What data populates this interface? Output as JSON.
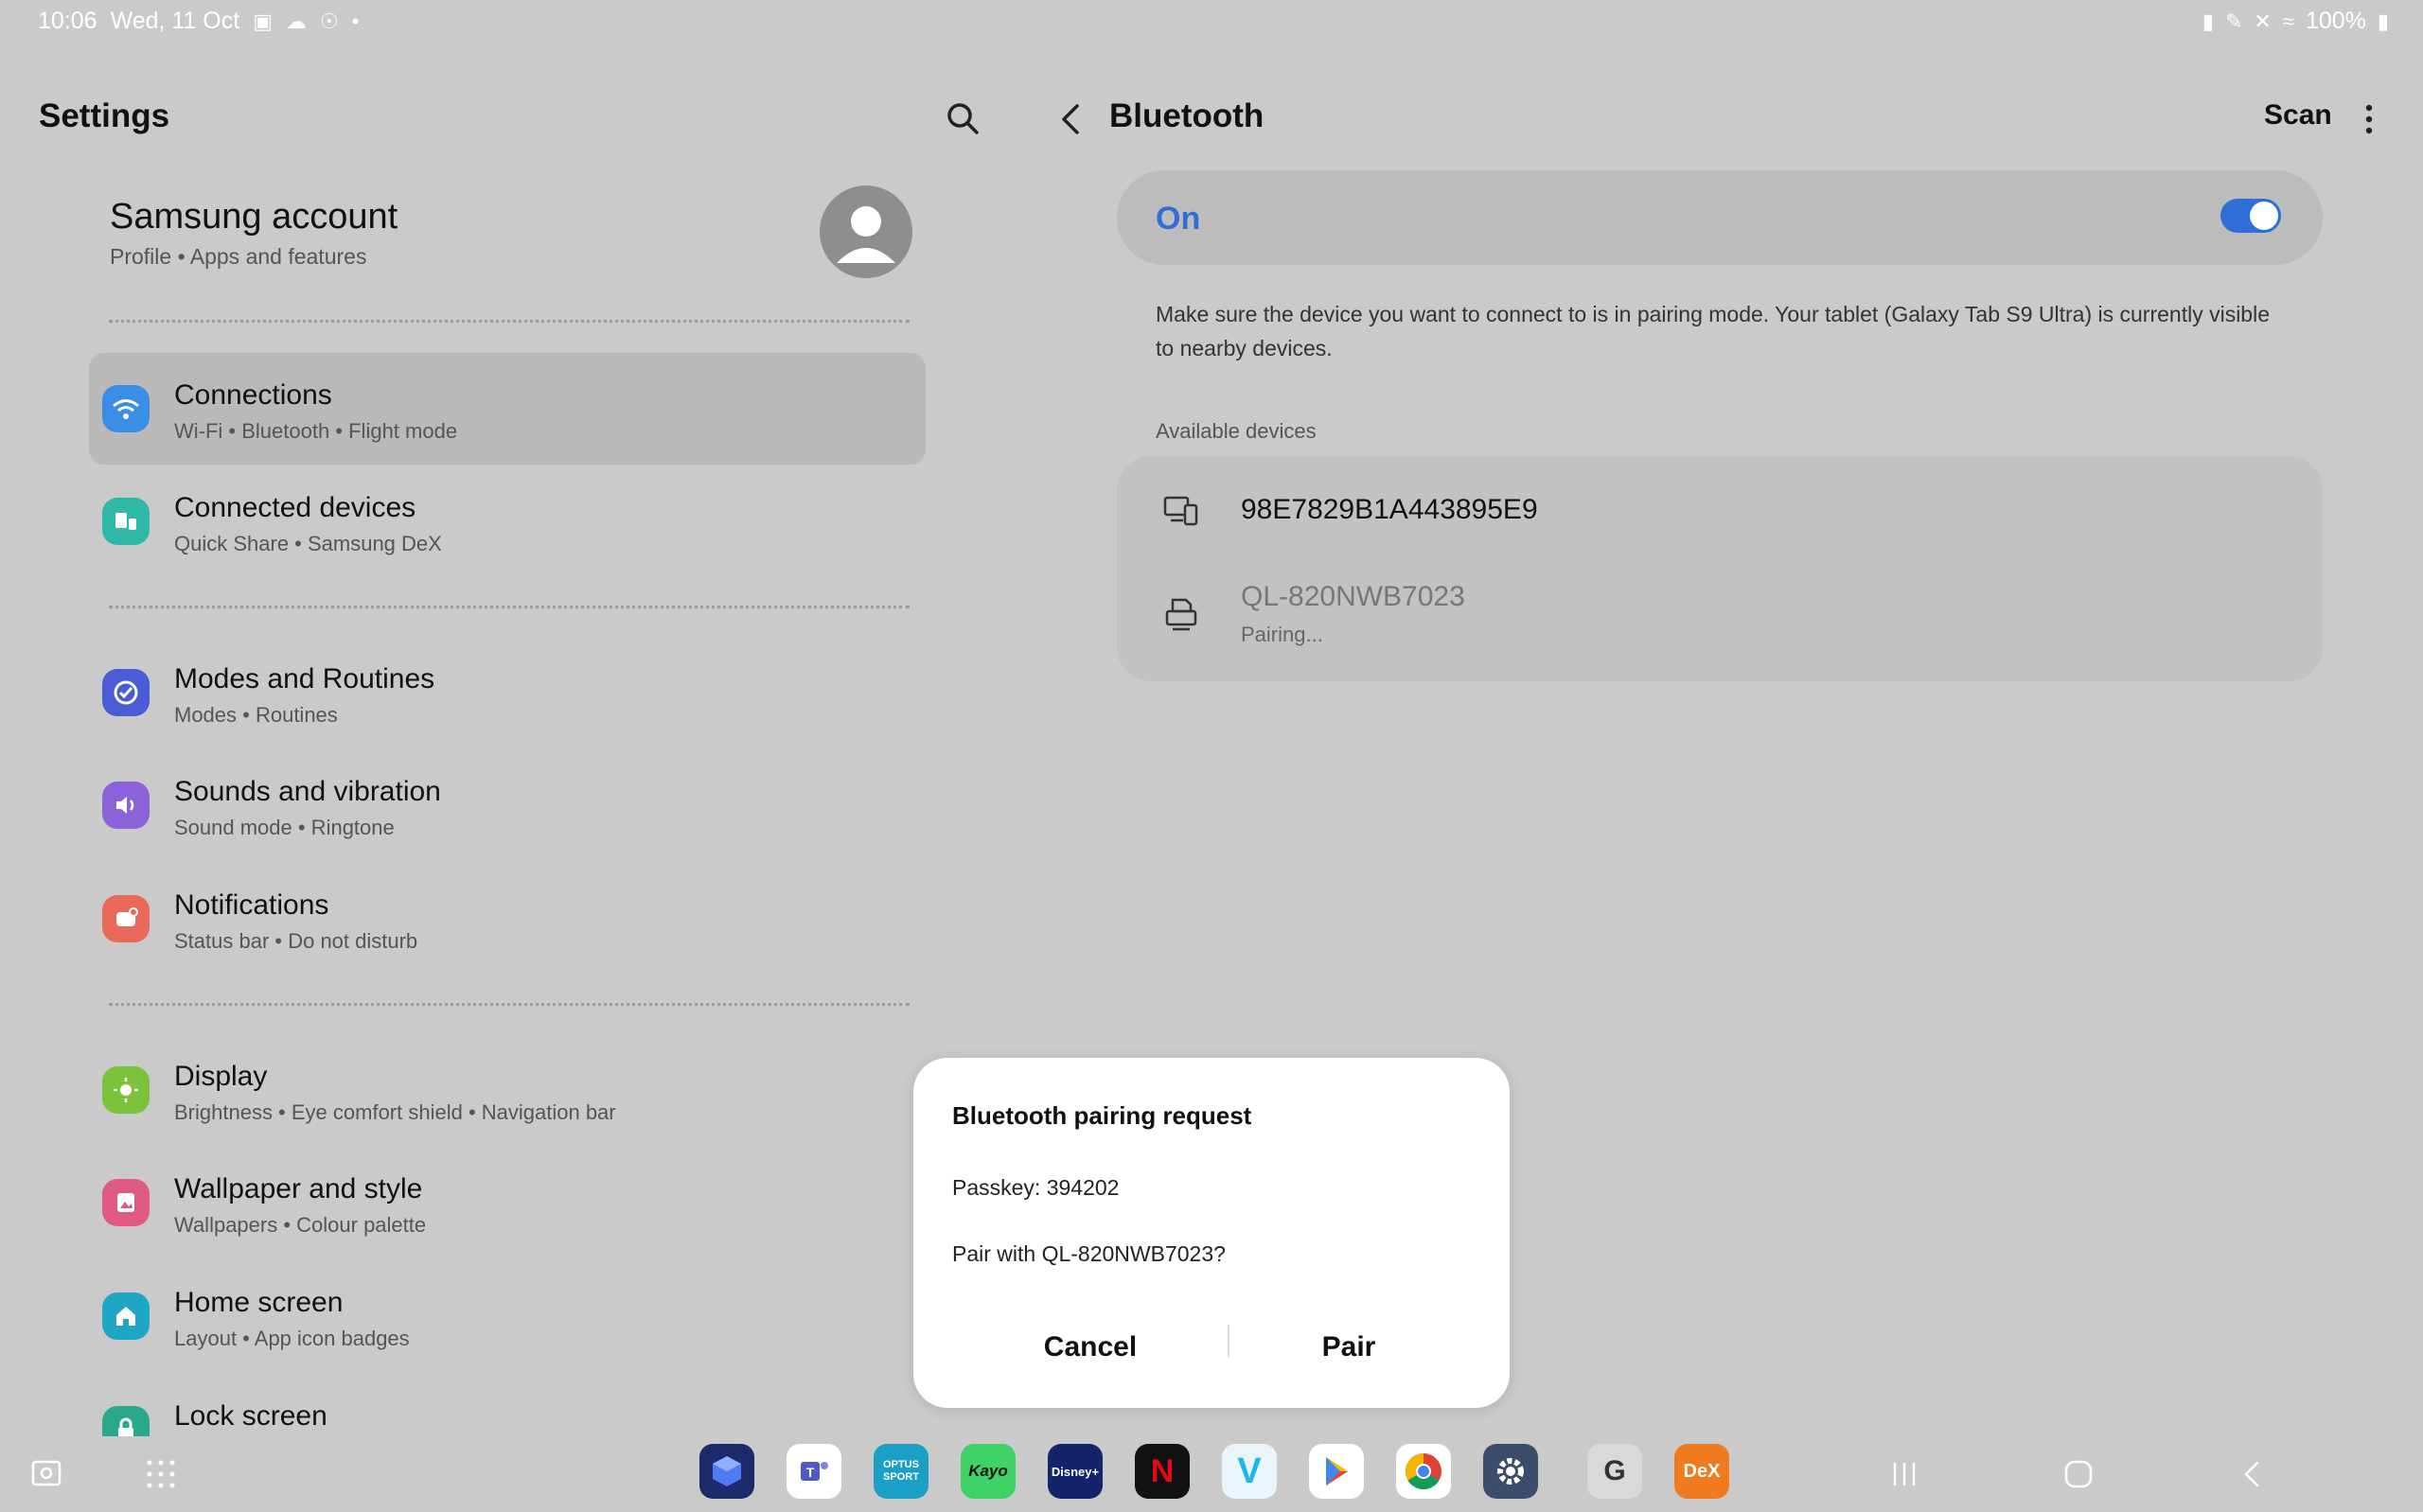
{
  "status_bar": {
    "time": "10:06",
    "date": "Wed, 11 Oct",
    "battery": "100%"
  },
  "left_pane": {
    "title": "Settings",
    "account": {
      "name": "Samsung account",
      "subtitle": "Profile  •  Apps and features"
    },
    "items": [
      {
        "title": "Connections",
        "subtitle": "Wi-Fi  •  Bluetooth  •  Flight mode",
        "icon": "wifi-icon",
        "color": "#3a8ee6"
      },
      {
        "title": "Connected devices",
        "subtitle": "Quick Share  •  Samsung DeX",
        "icon": "connected-devices-icon",
        "color": "#2fb7a8"
      },
      {
        "title": "Modes and Routines",
        "subtitle": "Modes  •  Routines",
        "icon": "routines-icon",
        "color": "#4a5bd6"
      },
      {
        "title": "Sounds and vibration",
        "subtitle": "Sound mode  •  Ringtone",
        "icon": "sound-icon",
        "color": "#8b62d8"
      },
      {
        "title": "Notifications",
        "subtitle": "Status bar  •  Do not disturb",
        "icon": "notifications-icon",
        "color": "#e8695a"
      },
      {
        "title": "Display",
        "subtitle": "Brightness  •  Eye comfort shield  •  Navigation bar",
        "icon": "display-icon",
        "color": "#7cc23a"
      },
      {
        "title": "Wallpaper and style",
        "subtitle": "Wallpapers  •  Colour palette",
        "icon": "wallpaper-icon",
        "color": "#e05a82"
      },
      {
        "title": "Home screen",
        "subtitle": "Layout  •  App icon badges",
        "icon": "home-icon",
        "color": "#1fa6c4"
      },
      {
        "title": "Lock screen",
        "subtitle": "",
        "icon": "lock-icon",
        "color": "#2aa98a"
      }
    ]
  },
  "right_pane": {
    "title": "Bluetooth",
    "scan_label": "Scan",
    "toggle_label": "On",
    "toggle_on": true,
    "info": "Make sure the device you want to connect to is in pairing mode. Your tablet (Galaxy Tab S9 Ultra) is currently visible to nearby devices.",
    "available_label": "Available devices",
    "devices": [
      {
        "name": "98E7829B1A443895E9",
        "status": "",
        "icon": "devices-icon"
      },
      {
        "name": "QL-820NWB7023",
        "status": "Pairing...",
        "icon": "printer-icon"
      }
    ]
  },
  "dialog": {
    "title": "Bluetooth pairing request",
    "passkey": "Passkey: 394202",
    "question": "Pair with QL-820NWB7023?",
    "cancel_label": "Cancel",
    "pair_label": "Pair"
  },
  "taskbar": {
    "apps": [
      {
        "name": "cube-app",
        "color": "#1b2a6b",
        "label": ""
      },
      {
        "name": "teams-app",
        "color": "#ffffff",
        "label": ""
      },
      {
        "name": "optus-sport-app",
        "color": "#1aa0c7",
        "label": "OPTUS SPORT"
      },
      {
        "name": "kayo-app",
        "color": "#3ed267",
        "label": "Kayo"
      },
      {
        "name": "disney-plus-app",
        "color": "#13246b",
        "label": "Disney+"
      },
      {
        "name": "netflix-app",
        "color": "#111111",
        "label": "N"
      },
      {
        "name": "vimeo-app",
        "color": "#e9f4fb",
        "label": "V"
      },
      {
        "name": "play-store-app",
        "color": "#ffffff",
        "label": ""
      },
      {
        "name": "chrome-app",
        "color": "#ffffff",
        "label": ""
      },
      {
        "name": "settings-app",
        "color": "#3b4d6b",
        "label": ""
      },
      {
        "name": "galaxy-store-app",
        "color": "#d9d9d9",
        "label": "G"
      },
      {
        "name": "dex-app",
        "color": "#f07b1f",
        "label": "DeX"
      }
    ]
  }
}
